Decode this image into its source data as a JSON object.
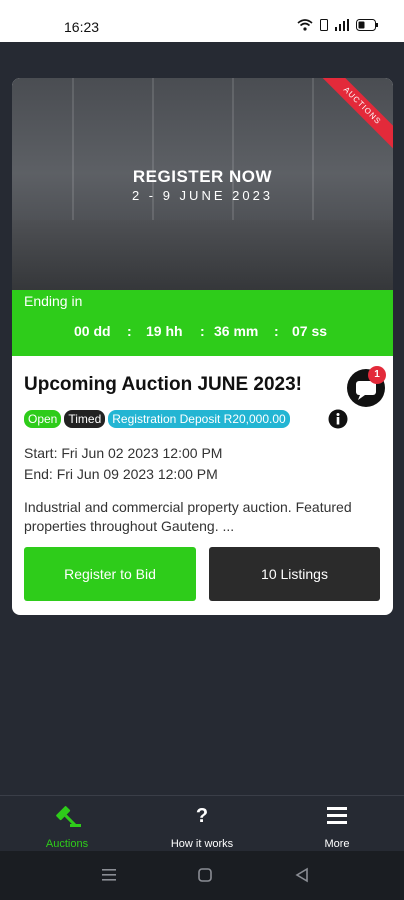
{
  "status": {
    "time": "16:23"
  },
  "banner": {
    "title": "REGISTER NOW",
    "dates": "2 - 9 JUNE 2023",
    "ribbon": "AUCTIONS"
  },
  "countdown": {
    "label": "Ending in",
    "days": "00 dd",
    "hours": "19 hh",
    "minutes": "36 mm",
    "seconds": "07 ss",
    "sep": ":"
  },
  "auction": {
    "title": "Upcoming Auction JUNE 2023!",
    "badges": [
      "Open",
      "Timed",
      "Registration Deposit R20,000.00"
    ],
    "start": "Start: Fri Jun 02 2023 12:00 PM",
    "end": "End: Fri Jun 09 2023 12:00 PM",
    "description": "Industrial and commercial property auction. Featured properties throughout Gauteng. ...",
    "notification_count": "1"
  },
  "actions": {
    "register": "Register to Bid",
    "listings": "10 Listings"
  },
  "bottom_nav": {
    "items": [
      {
        "label": "Auctions",
        "icon": "gavel-icon",
        "active": true
      },
      {
        "label": "How it works",
        "icon": "question-icon",
        "active": false
      },
      {
        "label": "More",
        "icon": "menu-icon",
        "active": false
      }
    ]
  },
  "colors": {
    "accent": "#2ecc1a",
    "dark": "#262a33",
    "deposit": "#23b5d3",
    "ribbon": "#e32a3a"
  }
}
